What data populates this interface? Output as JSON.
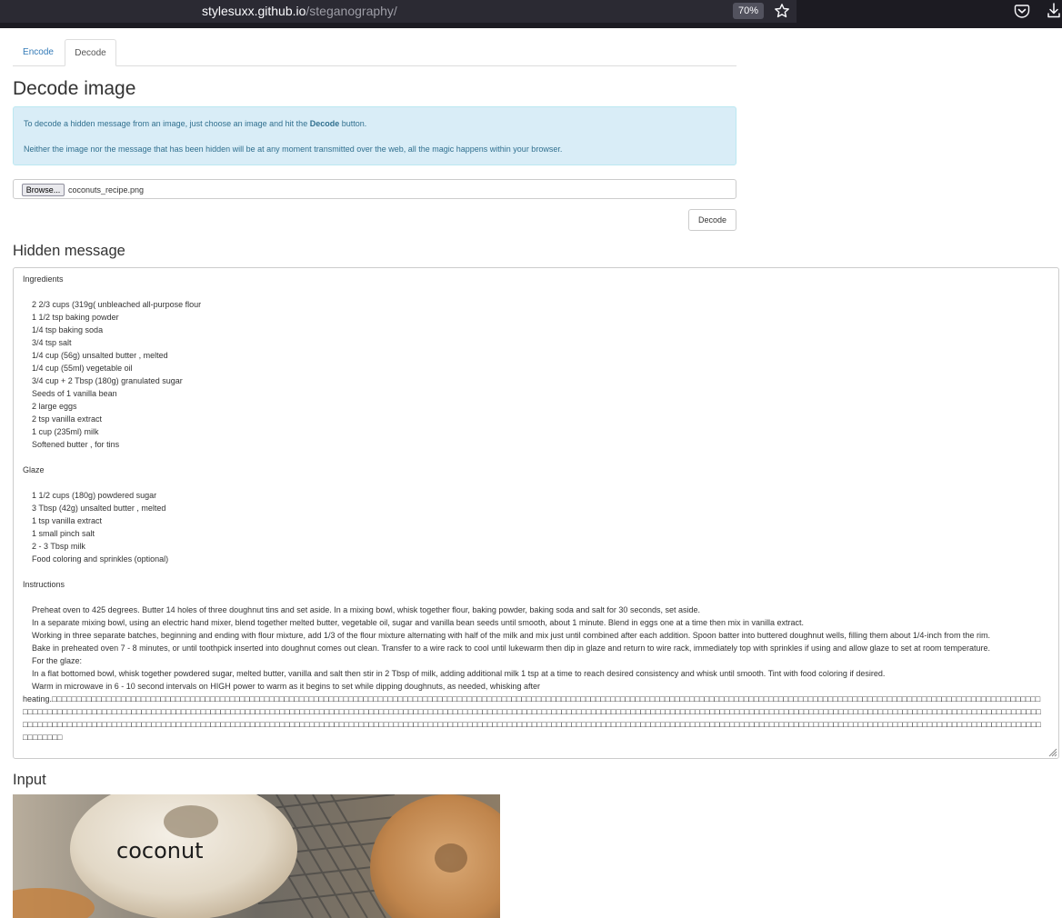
{
  "browser": {
    "url_host": "stylesuxx.github.io",
    "url_path": "/steganography/",
    "zoom": "70%"
  },
  "tabs": [
    {
      "label": "Encode",
      "active": false
    },
    {
      "label": "Decode",
      "active": true
    }
  ],
  "decode": {
    "title": "Decode image",
    "info_line1_before": "To decode a hidden message from an image, just choose an image and hit the ",
    "info_line1_bold": "Decode",
    "info_line1_after": " button.",
    "info_line2": "Neither the image nor the message that has been hidden will be at any moment transmitted over the web, all the magic happens within your browser.",
    "browse_label": "Browse...",
    "file_name": "coconuts_recipe.png",
    "decode_button": "Decode"
  },
  "hidden_message": {
    "title": "Hidden message",
    "lines": [
      "Ingredients",
      "",
      "    2 2/3 cups (319g( unbleached all-purpose flour",
      "    1 1/2 tsp baking powder",
      "    1/4 tsp baking soda",
      "    3/4 tsp salt",
      "    1/4 cup (56g) unsalted butter , melted",
      "    1/4 cup (55ml) vegetable oil",
      "    3/4 cup + 2 Tbsp (180g) granulated sugar",
      "    Seeds of 1 vanilla bean",
      "    2 large eggs",
      "    2 tsp vanilla extract",
      "    1 cup (235ml) milk",
      "    Softened butter , for tins",
      "",
      "Glaze",
      "",
      "    1 1/2 cups (180g) powdered sugar",
      "    3 Tbsp (42g) unsalted butter , melted",
      "    1 tsp vanilla extract",
      "    1 small pinch salt",
      "    2 - 3 Tbsp milk",
      "    Food coloring and sprinkles (optional)",
      "",
      "Instructions",
      "",
      "    Preheat oven to 425 degrees. Butter 14 holes of three doughnut tins and set aside. In a mixing bowl, whisk together flour, baking powder, baking soda and salt for 30 seconds, set aside.",
      "    In a separate mixing bowl, using an electric hand mixer, blend together melted butter, vegetable oil, sugar and vanilla bean seeds until smooth, about 1 minute. Blend in eggs one at a time then mix in vanilla extract.",
      "    Working in three separate batches, beginning and ending with flour mixture, add 1/3 of the flour mixture alternating with half of the milk and mix just until combined after each addition. Spoon batter into buttered doughnut wells, filling them about 1/4-inch from the rim.",
      "    Bake in preheated oven 7 - 8 minutes, or until toothpick inserted into doughnut comes out clean. Transfer to a wire rack to cool until lukewarm then dip in glaze and return to wire rack, immediately top with sprinkles if using and allow glaze to set at room temperature.",
      "    For the glaze:",
      "    In a flat bottomed bowl, whisk together powdered sugar, melted butter, vanilla and salt then stir in 2 Tbsp of milk, adding additional milk 1 tsp at a time to reach desired consistency and whisk until smooth. Tint with food coloring if desired.",
      "    Warm in microwave in 6 - 10 second intervals on HIGH power to warm as it begins to set while dipping doughnuts, as needed, whisking after",
      "heating."
    ],
    "garbage_glyph": "□",
    "garbage_count": 620
  },
  "input": {
    "title": "Input",
    "image_caption": "coconut"
  }
}
